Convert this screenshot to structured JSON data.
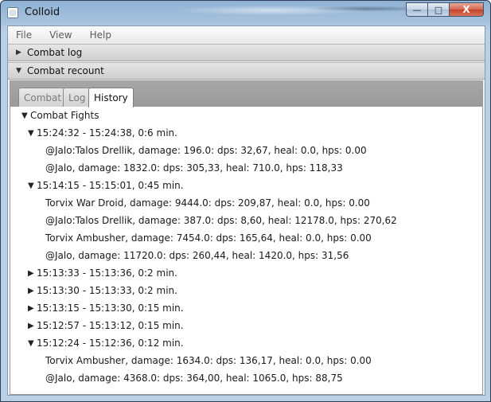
{
  "window": {
    "title": "Colloid",
    "buttons": {
      "minimize": "—",
      "maximize": "□",
      "close": "X"
    }
  },
  "menu": [
    "File",
    "View",
    "Help"
  ],
  "panes": {
    "combat_log": {
      "label": "Combat log",
      "expanded": false
    },
    "combat_recount": {
      "label": "Combat recount",
      "expanded": true
    }
  },
  "tabs": [
    {
      "label": "Combat",
      "active": false
    },
    {
      "label": "Log",
      "active": false
    },
    {
      "label": "History",
      "active": true
    }
  ],
  "tree": {
    "root": {
      "label": "Combat Fights",
      "expanded": true
    },
    "fights": [
      {
        "label": "15:24:32 - 15:24:38, 0:6 min.",
        "expanded": true,
        "entries": [
          "@Jalo:Talos Drellik, damage: 196.0: dps: 32,67, heal: 0.0, hps: 0.00",
          "@Jalo, damage: 1832.0: dps: 305,33, heal: 710.0, hps: 118,33"
        ]
      },
      {
        "label": "15:14:15 - 15:15:01, 0:45 min.",
        "expanded": true,
        "entries": [
          "Torvix War Droid, damage: 9444.0: dps: 209,87, heal: 0.0, hps: 0.00",
          "@Jalo:Talos Drellik, damage: 387.0: dps: 8,60, heal: 12178.0, hps: 270,62",
          "Torvix Ambusher, damage: 7454.0: dps: 165,64, heal: 0.0, hps: 0.00",
          "@Jalo, damage: 11720.0: dps: 260,44, heal: 1420.0, hps: 31,56"
        ]
      },
      {
        "label": "15:13:33 - 15:13:36, 0:2 min.",
        "expanded": false,
        "entries": []
      },
      {
        "label": "15:13:30 - 15:13:33, 0:2 min.",
        "expanded": false,
        "entries": []
      },
      {
        "label": "15:13:15 - 15:13:30, 0:15 min.",
        "expanded": false,
        "entries": []
      },
      {
        "label": "15:12:57 - 15:13:12, 0:15 min.",
        "expanded": false,
        "entries": []
      },
      {
        "label": "15:12:24 - 15:12:36, 0:12 min.",
        "expanded": true,
        "entries": [
          "Torvix Ambusher, damage: 1634.0: dps: 136,17, heal: 0.0, hps: 0.00",
          "@Jalo, damage: 4368.0: dps: 364,00, heal: 1065.0, hps: 88,75"
        ]
      }
    ]
  },
  "icons": {
    "expanded": "▼",
    "collapsed": "▶"
  }
}
